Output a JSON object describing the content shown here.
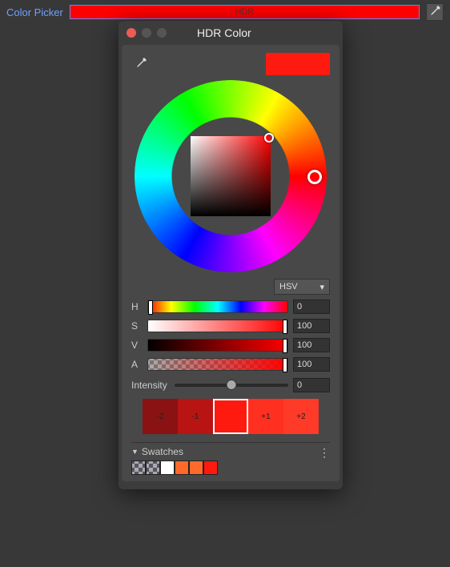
{
  "topbar": {
    "label": "Color Picker",
    "field_text": "HDR",
    "color": "#ff0000"
  },
  "panel": {
    "title": "HDR Color",
    "current_color": "#ff1a10",
    "mode": "HSV",
    "sliders": {
      "h": {
        "label": "H",
        "value": "0"
      },
      "s": {
        "label": "S",
        "value": "100"
      },
      "v": {
        "label": "V",
        "value": "100"
      },
      "a": {
        "label": "A",
        "value": "100"
      }
    },
    "intensity": {
      "label": "Intensity",
      "value": "0"
    },
    "steps": {
      "m2": {
        "label": "-2",
        "color": "#8a1212"
      },
      "m1": {
        "label": "-1",
        "color": "#b81414"
      },
      "c": {
        "label": "",
        "color": "#ff1a10"
      },
      "p1": {
        "label": "+1",
        "color": "#ff3020"
      },
      "p2": {
        "label": "+2",
        "color": "#ff3a28"
      }
    },
    "swatches": {
      "label": "Swatches",
      "items": [
        {
          "color": "checker"
        },
        {
          "color": "checker"
        },
        {
          "color": "#ffffff"
        },
        {
          "color": "#ff6a2a"
        },
        {
          "color": "#ff6a2a"
        },
        {
          "color": "#ff1a10"
        }
      ]
    }
  }
}
